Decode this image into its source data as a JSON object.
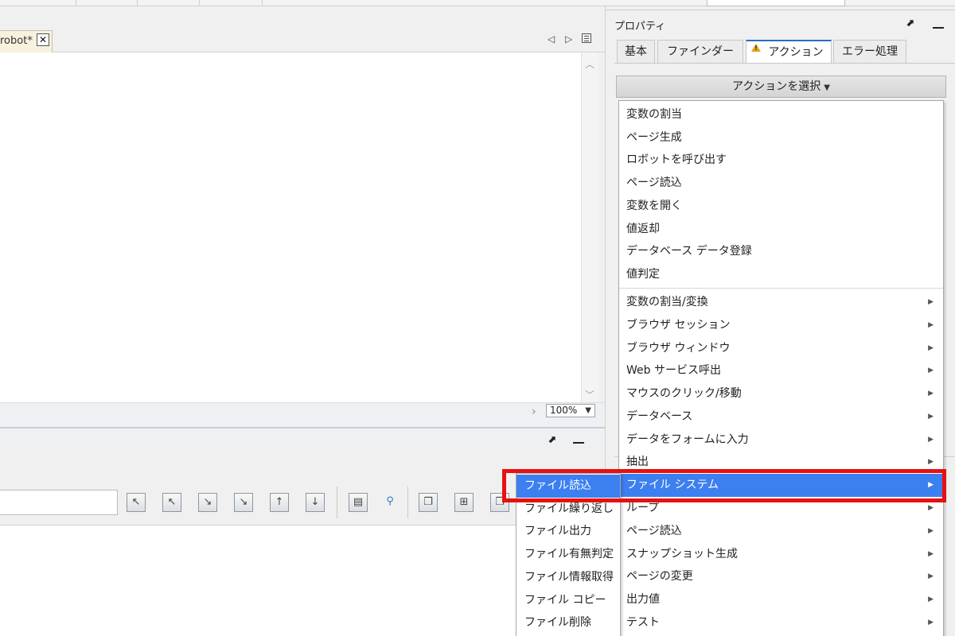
{
  "editor": {
    "tab_label": "robot*",
    "close_glyph": "✕",
    "zoom_value": "100%"
  },
  "properties": {
    "title": "プロパティ",
    "tabs": [
      {
        "label": "基本"
      },
      {
        "label": "ファインダー"
      },
      {
        "label": "アクション",
        "active": true,
        "warning": true
      },
      {
        "label": "エラー処理"
      }
    ],
    "select_action_label": "アクションを選択"
  },
  "action_menu": {
    "items": [
      {
        "label": "変数の割当"
      },
      {
        "label": "ページ生成"
      },
      {
        "label": "ロボットを呼び出す"
      },
      {
        "label": "ページ読込"
      },
      {
        "label": "変数を開く"
      },
      {
        "label": "値返却"
      },
      {
        "label": "データベース データ登録"
      },
      {
        "label": "値判定"
      }
    ],
    "groups": [
      {
        "label": "変数の割当/変換"
      },
      {
        "label": "ブラウザ セッション"
      },
      {
        "label": "ブラウザ ウィンドウ"
      },
      {
        "label": "Web サービス呼出"
      },
      {
        "label": "マウスのクリック/移動"
      },
      {
        "label": "データベース"
      },
      {
        "label": "データをフォームに入力"
      },
      {
        "label": "抽出"
      },
      {
        "label": "ファイル システム",
        "highlighted": true
      },
      {
        "label": "ループ"
      },
      {
        "label": "ページ読込"
      },
      {
        "label": "スナップショット生成"
      },
      {
        "label": "ページの変更"
      },
      {
        "label": "出力値"
      },
      {
        "label": "テスト"
      }
    ]
  },
  "file_system_submenu": {
    "items": [
      {
        "label": "ファイル読込",
        "highlighted": true
      },
      {
        "label": "ファイル繰り返し"
      },
      {
        "label": "ファイル出力"
      },
      {
        "label": "ファイル有無判定"
      },
      {
        "label": "ファイル情報取得"
      },
      {
        "label": "ファイル コピー"
      },
      {
        "label": "ファイル削除"
      }
    ]
  },
  "icons": {
    "submenu_arrow": "▶",
    "dropdown_arrow": "▼",
    "tab_left": "◁",
    "tab_right": "▷",
    "scroll_up": "︿",
    "scroll_down": "﹀",
    "status_chevron": "›",
    "maximize": "⬈"
  },
  "colors": {
    "highlight": "#3c7ff0",
    "annotation": "#e81010",
    "active_tab_accent": "#2e6bc5",
    "warning": "#e8a317"
  }
}
